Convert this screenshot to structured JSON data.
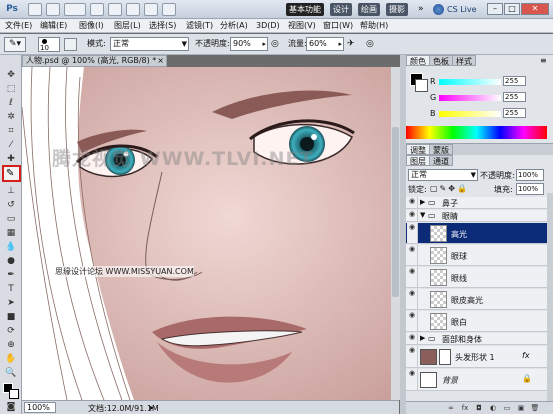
{
  "app": {
    "logo": "Ps"
  },
  "titlebar": {
    "workspaces": [
      "基本功能",
      "设计",
      "绘画",
      "摄影"
    ],
    "cslive": "CS Live",
    "icons": [
      "bridge-icon",
      "mini-bridge-icon",
      "zoom-level-icon",
      "hand-icon",
      "zoom-tool-icon",
      "rotate-view-icon",
      "arrange-documents-icon",
      "screen-mode-icon"
    ]
  },
  "menu": [
    "文件(E)",
    "编辑(E)",
    "图像(I)",
    "图层(L)",
    "选择(S)",
    "滤镜(T)",
    "分析(A)",
    "3D(D)",
    "视图(V)",
    "窗口(W)",
    "帮助(H)"
  ],
  "options": {
    "brush_size": "10",
    "mode_label": "模式:",
    "mode_value": "正常",
    "opacity_label": "不透明度:",
    "opacity_value": "90%",
    "flow_label": "流量:",
    "flow_value": "60%"
  },
  "document": {
    "tab_title": "人物.psd @ 100% (高光, RGB/8) *",
    "zoom": "100%",
    "doc_size": "文档:12.0M/91.1M"
  },
  "canvas_overlay": {
    "watermark_cn": "腾龙视觉",
    "watermark_en": "WWW.TLVI.NET",
    "source": "思缘设计论坛 WWW.MISSYUAN.COM"
  },
  "color_panel": {
    "tabs": [
      "颜色",
      "色板",
      "样式"
    ],
    "channels": [
      {
        "label": "R",
        "value": "255"
      },
      {
        "label": "G",
        "value": "255"
      },
      {
        "label": "B",
        "value": "255"
      }
    ]
  },
  "adjust_tabs": [
    "调整",
    "蒙版"
  ],
  "layers_panel": {
    "tabs": [
      "图层",
      "通道"
    ],
    "blend_mode": "正常",
    "opacity_label": "不透明度:",
    "opacity_value": "100%",
    "lock_label": "锁定:",
    "fill_label": "填充:",
    "fill_value": "100%",
    "rows": [
      {
        "type": "group",
        "name": "鼻子",
        "expanded": false
      },
      {
        "type": "group",
        "name": "眼睛",
        "expanded": true
      },
      {
        "type": "layer",
        "name": "高光",
        "selected": true
      },
      {
        "type": "layer",
        "name": "眼球"
      },
      {
        "type": "layer",
        "name": "眼线"
      },
      {
        "type": "layer",
        "name": "眼皮高光"
      },
      {
        "type": "layer",
        "name": "眼白"
      },
      {
        "type": "group",
        "name": "面部和身体",
        "expanded": false
      },
      {
        "type": "shape",
        "name": "头发形状 1",
        "fx": "fx"
      },
      {
        "type": "background",
        "name": "背景"
      }
    ]
  },
  "colors": {
    "accent_selection": "#0b2a78",
    "highlight_box": "#d51f1f",
    "skin": "#e4c6c2",
    "lip": "#a86a68",
    "iris": "#3aa8b8"
  }
}
